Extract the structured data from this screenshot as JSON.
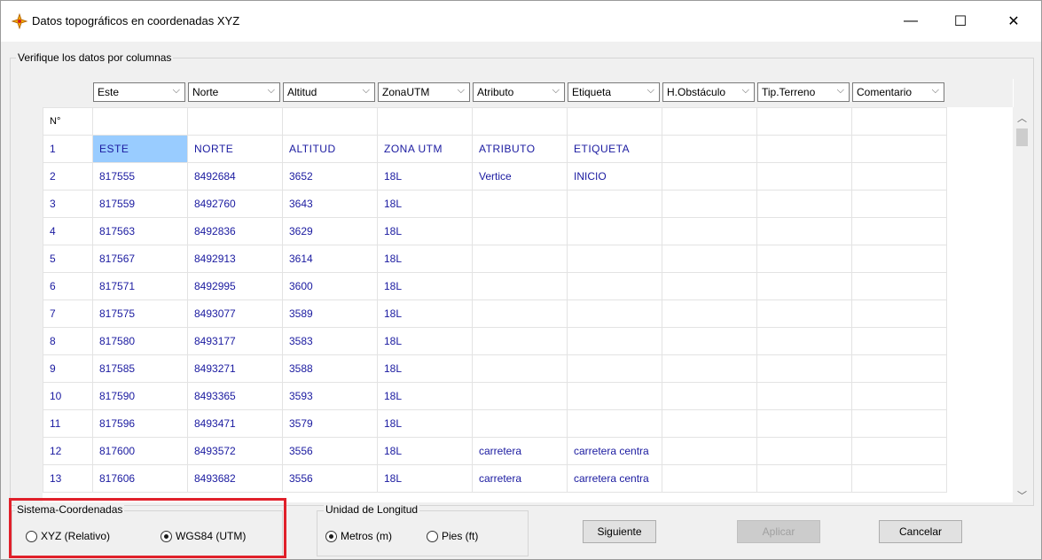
{
  "window": {
    "title": "Datos topográficos en coordenadas XYZ",
    "minimize_glyph": "—",
    "maximize_glyph": "☐",
    "close_glyph": "✕"
  },
  "group_columns": {
    "label": "Verifique los datos por columnas"
  },
  "column_selectors": [
    "Este",
    "Norte",
    "Altitud",
    "ZonaUTM",
    "Atributo",
    "Etiqueta",
    "H.Obstáculo",
    "Tip.Terreno",
    "Comentario"
  ],
  "grid": {
    "header_label": "N°",
    "rows": [
      [
        "1",
        "ESTE",
        "NORTE",
        "ALTITUD",
        "ZONA UTM",
        "ATRIBUTO",
        "ETIQUETA",
        "",
        "",
        ""
      ],
      [
        "2",
        "817555",
        "8492684",
        "3652",
        "18L",
        "Vertice",
        "INICIO",
        "",
        "",
        ""
      ],
      [
        "3",
        "817559",
        "8492760",
        "3643",
        "18L",
        "",
        "",
        "",
        "",
        ""
      ],
      [
        "4",
        "817563",
        "8492836",
        "3629",
        "18L",
        "",
        "",
        "",
        "",
        ""
      ],
      [
        "5",
        "817567",
        "8492913",
        "3614",
        "18L",
        "",
        "",
        "",
        "",
        ""
      ],
      [
        "6",
        "817571",
        "8492995",
        "3600",
        "18L",
        "",
        "",
        "",
        "",
        ""
      ],
      [
        "7",
        "817575",
        "8493077",
        "3589",
        "18L",
        "",
        "",
        "",
        "",
        ""
      ],
      [
        "8",
        "817580",
        "8493177",
        "3583",
        "18L",
        "",
        "",
        "",
        "",
        ""
      ],
      [
        "9",
        "817585",
        "8493271",
        "3588",
        "18L",
        "",
        "",
        "",
        "",
        ""
      ],
      [
        "10",
        "817590",
        "8493365",
        "3593",
        "18L",
        "",
        "",
        "",
        "",
        ""
      ],
      [
        "11",
        "817596",
        "8493471",
        "3579",
        "18L",
        "",
        "",
        "",
        "",
        ""
      ],
      [
        "12",
        "817600",
        "8493572",
        "3556",
        "18L",
        "carretera",
        "carretera centra",
        "",
        "",
        ""
      ],
      [
        "13",
        "817606",
        "8493682",
        "3556",
        "18L",
        "carretera",
        "carretera centra",
        "",
        "",
        ""
      ]
    ]
  },
  "sistema": {
    "label": "Sistema-Coordenadas",
    "options": [
      {
        "label": "XYZ (Relativo)",
        "selected": false
      },
      {
        "label": "WGS84 (UTM)",
        "selected": true
      }
    ]
  },
  "unidad": {
    "label": "Unidad de Longitud",
    "options": [
      {
        "label": "Metros (m)",
        "selected": true
      },
      {
        "label": "Pies (ft)",
        "selected": false
      }
    ]
  },
  "buttons": {
    "siguiente": "Siguiente",
    "aplicar": "Aplicar",
    "cancelar": "Cancelar"
  },
  "colors": {
    "highlight": "#e0202a",
    "selected_cell": "#99ccff",
    "cell_text": "#1a1aa0"
  }
}
